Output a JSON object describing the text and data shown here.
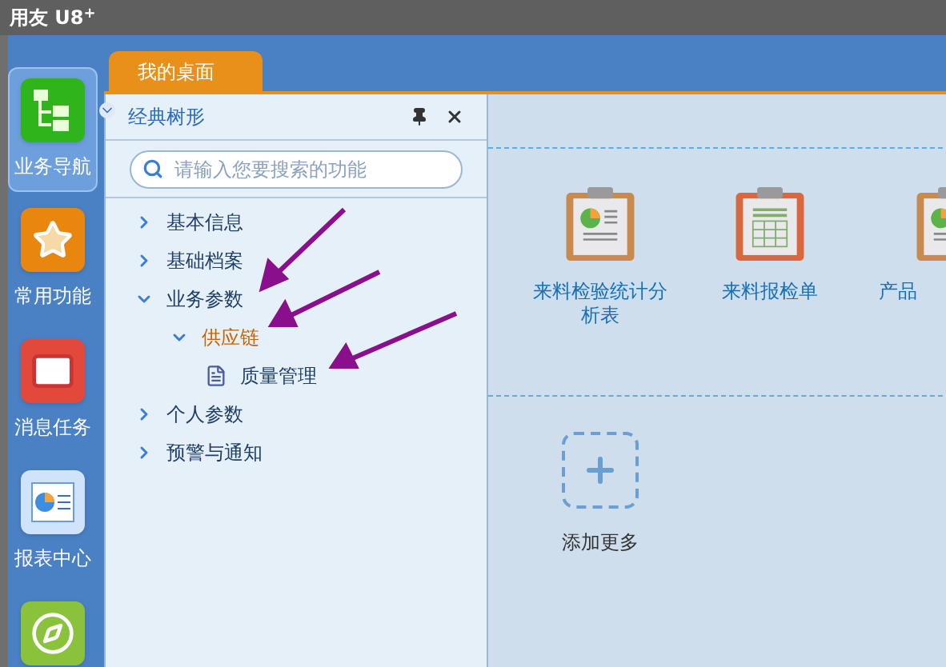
{
  "window": {
    "title": "用友 U8",
    "title_sup": "+"
  },
  "nav": [
    {
      "label": "业务导航",
      "kind": "tree",
      "selected": true
    },
    {
      "label": "常用功能",
      "kind": "star",
      "selected": false
    },
    {
      "label": "消息任务",
      "kind": "mail",
      "selected": false
    },
    {
      "label": "报表中心",
      "kind": "report",
      "selected": false
    },
    {
      "kind": "compass",
      "selected": false
    }
  ],
  "tabs": [
    {
      "label": "我的桌面",
      "selected": true
    }
  ],
  "tree_panel": {
    "title": "经典树形",
    "search": {
      "placeholder": "请输入您要搜索的功能"
    },
    "items": [
      {
        "label": "基本信息",
        "kind": "folder",
        "expanded": false,
        "selected": false
      },
      {
        "label": "基础档案",
        "kind": "folder",
        "expanded": false,
        "selected": false
      },
      {
        "label": "业务参数",
        "kind": "folder",
        "expanded": true,
        "selected": false,
        "children": [
          {
            "label": "供应链",
            "kind": "folder",
            "expanded": true,
            "selected": true,
            "children": [
              {
                "label": "质量管理",
                "kind": "leaf",
                "selected": false
              }
            ]
          }
        ]
      },
      {
        "label": "个人参数",
        "kind": "folder",
        "expanded": false,
        "selected": false
      },
      {
        "label": "预警与通知",
        "kind": "folder",
        "expanded": false,
        "selected": false
      }
    ]
  },
  "desktop": {
    "apps": [
      {
        "label": "来料检验统计分析表",
        "kind": "chart"
      },
      {
        "label": "来料报检单",
        "kind": "table"
      },
      {
        "label": "产品",
        "kind": "chart"
      }
    ],
    "add_more": {
      "label": "添加更多"
    }
  }
}
